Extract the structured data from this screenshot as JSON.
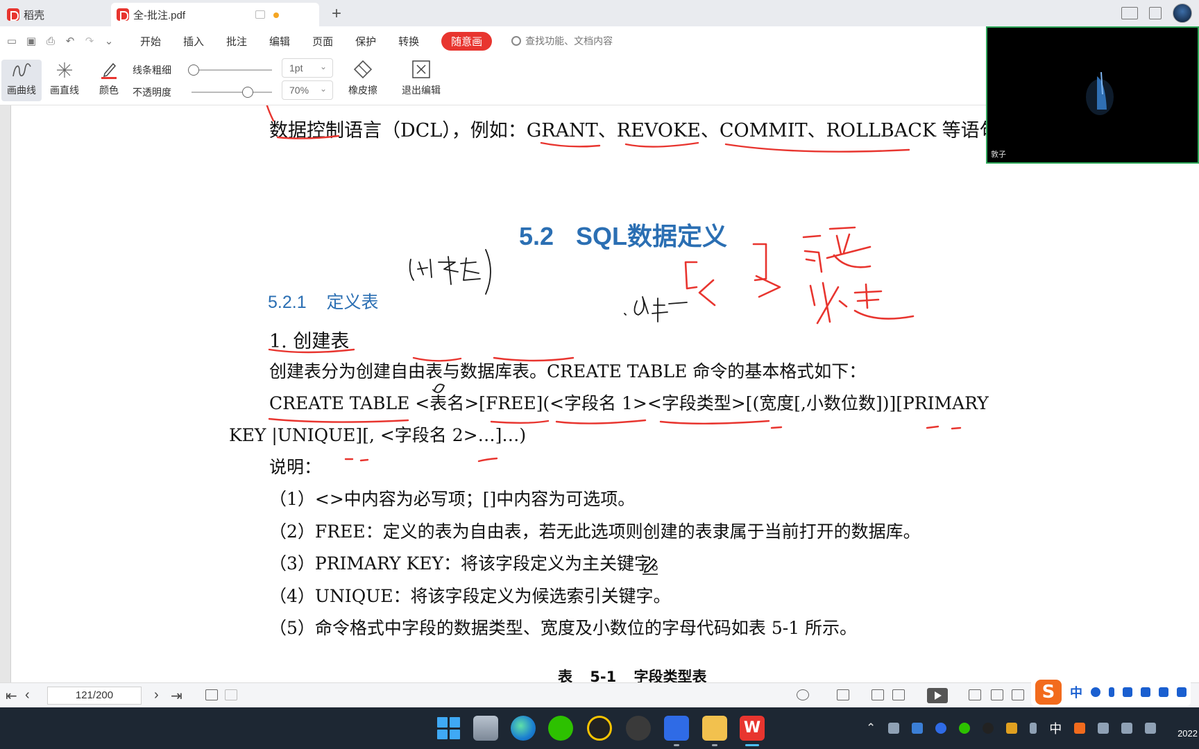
{
  "titlebar": {
    "home_tab": "稻壳",
    "doc_tab": "全-批注.pdf",
    "new_tab": "+"
  },
  "menu": {
    "items": [
      "开始",
      "插入",
      "批注",
      "编辑",
      "页面",
      "保护",
      "转换"
    ],
    "active": "随意画",
    "search_placeholder": "查找功能、文档内容"
  },
  "toolbar": {
    "curve": "画曲线",
    "line": "画直线",
    "color": "颜色",
    "width_label": "线条粗细",
    "opacity_label": "不透明度",
    "width_value": "1pt",
    "opacity_value": "70%",
    "eraser": "橡皮擦",
    "exit": "退出编辑",
    "pen_color": "#e8352f",
    "width_level": 0.0,
    "opacity_level": 0.7
  },
  "document": {
    "line_dcl": "数据控制语言（DCL），例如：GRANT、REVOKE、COMMIT、ROLLBACK 等语句",
    "section_heading": "5.2 SQL数据定义",
    "sub_heading": "5.2.1 定义表",
    "heading_create": "1. 创建表",
    "intro": "创建表分为创建自由表与数据库表。CREATE TABLE 命令的基本格式如下：",
    "syntax_line1": "CREATE TABLE <表名>[FREE](<字段名 1><字段类型>[(宽度[,小数位数])][PRIMARY",
    "syntax_line2": "KEY |UNIQUE][, <字段名 2>…]…)",
    "note": "说明：",
    "items": [
      "（1）<>中内容为必写项；[]中内容为可选项。",
      "（2）FREE：定义的表为自由表，若无此选项则创建的表隶属于当前打开的数据库。",
      "（3）PRIMARY KEY：将该字段定义为主关键字。",
      "（4）UNIQUE：将该字段定义为候选索引关键字。",
      "（5）命令格式中字段的数据类型、宽度及小数位的字母代码如表 5-1 所示。"
    ],
    "table_caption": "表 5-1 字段类型表",
    "accent_color": "#2b6fb3",
    "ink_color": "#e8352f"
  },
  "video": {
    "name": "敦子"
  },
  "statusbar": {
    "page": "121/200"
  },
  "ime": {
    "logo": "S",
    "mode": "中"
  },
  "taskbar": {
    "tray_ime": "中",
    "clock": "2022"
  }
}
